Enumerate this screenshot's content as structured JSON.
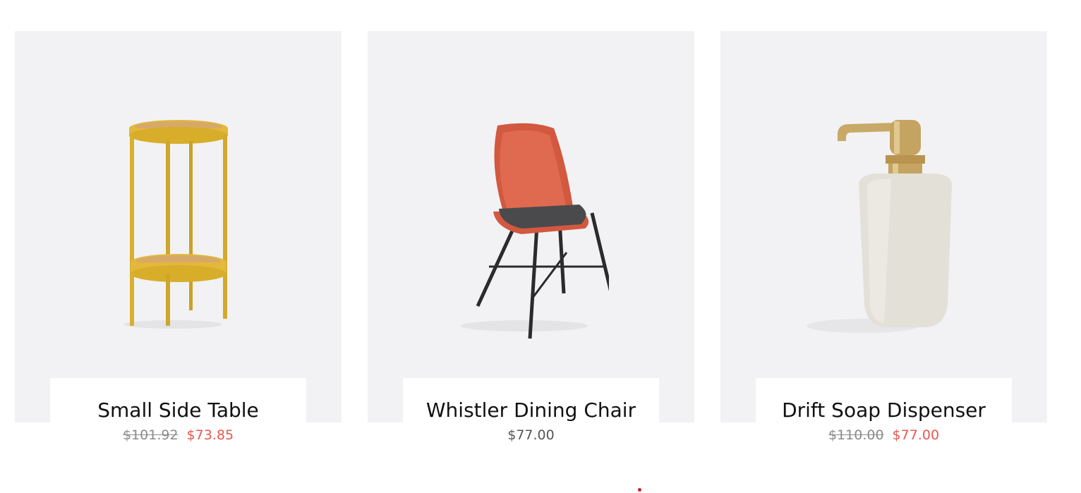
{
  "products": [
    {
      "icon": "side-table-image",
      "title": "Small Side Table",
      "old_price": "$101.92",
      "price": "$73.85",
      "on_sale": true
    },
    {
      "icon": "dining-chair-image",
      "title": "Whistler Dining Chair",
      "old_price": "",
      "price": "$77.00",
      "on_sale": false
    },
    {
      "icon": "soap-dispenser-image",
      "title": "Drift Soap Dispenser",
      "old_price": "$110.00",
      "price": "$77.00",
      "on_sale": true
    }
  ],
  "colors": {
    "card_background": "#f2f2f4",
    "sale_price": "#e8574f",
    "old_price": "#8a8a8a",
    "regular_price": "#555555",
    "indicator_dot": "#d71920"
  }
}
